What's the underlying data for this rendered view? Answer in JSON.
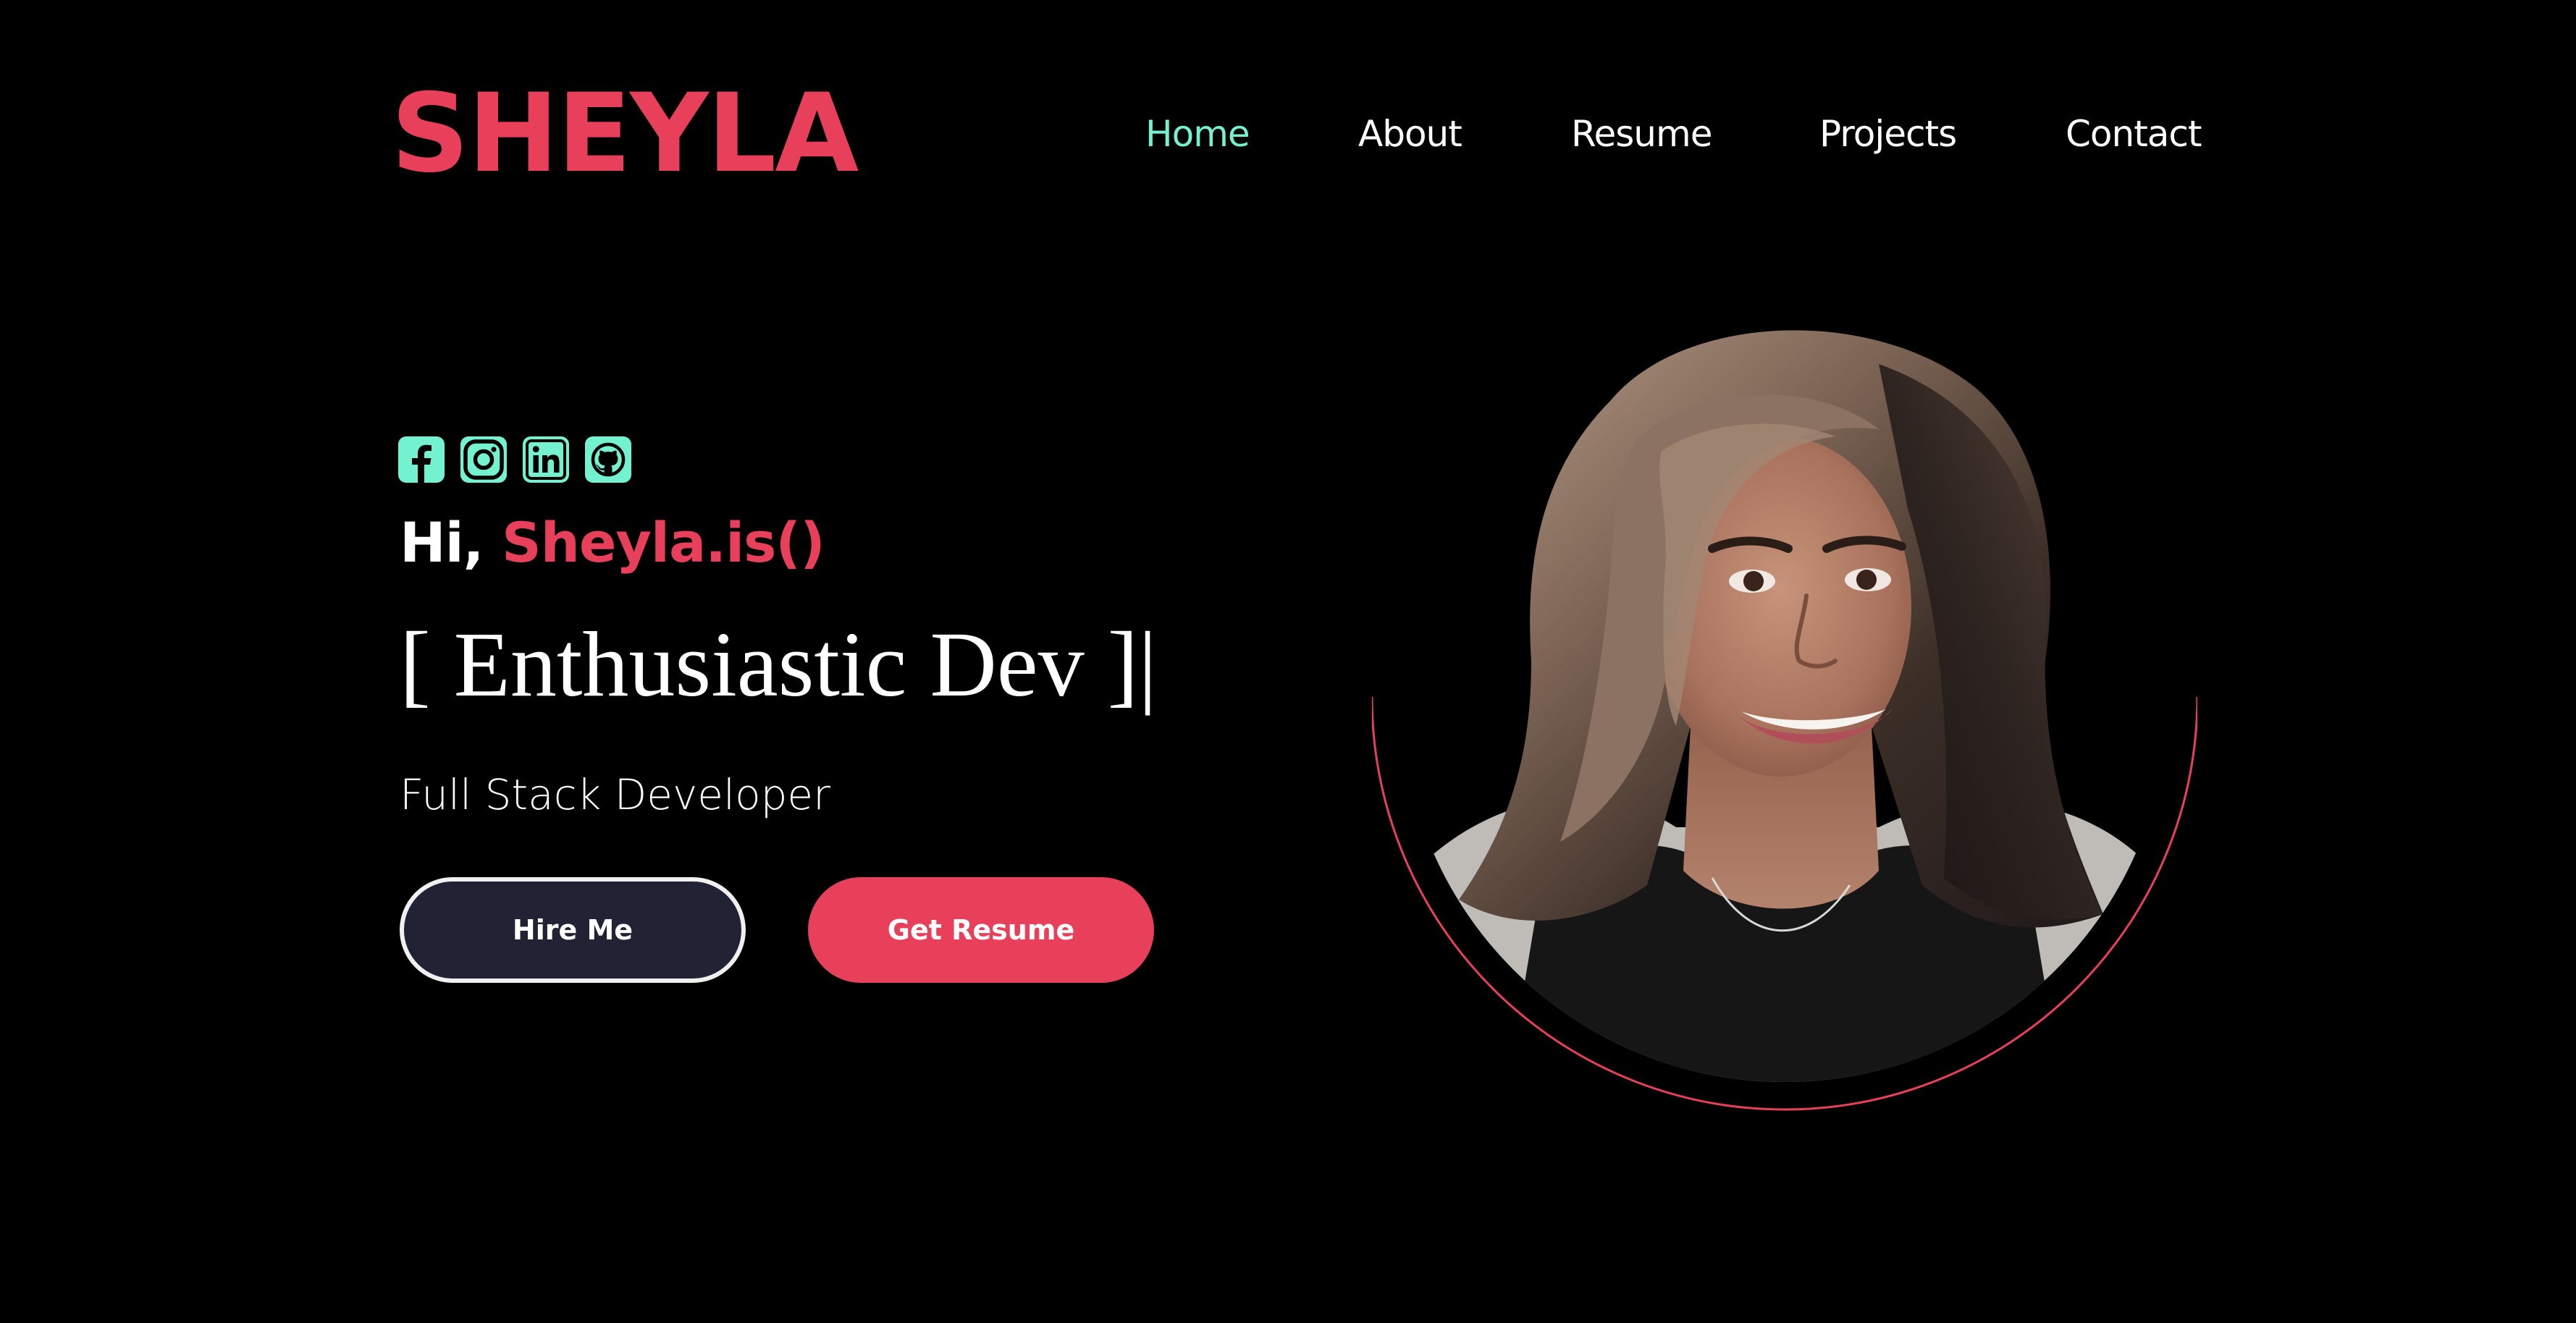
{
  "brand": {
    "logo": "SHEYLA",
    "color": "#e8405b"
  },
  "nav": {
    "items": [
      {
        "id": "home",
        "label": "Home",
        "active": true
      },
      {
        "id": "about",
        "label": "About",
        "active": false
      },
      {
        "id": "resume",
        "label": "Resume",
        "active": false
      },
      {
        "id": "projects",
        "label": "Projects",
        "active": false
      },
      {
        "id": "contact",
        "label": "Contact",
        "active": false
      }
    ],
    "active_color": "#74f2cf"
  },
  "socials": [
    {
      "icon": "facebook-icon"
    },
    {
      "icon": "instagram-icon"
    },
    {
      "icon": "linkedin-icon"
    },
    {
      "icon": "github-icon"
    }
  ],
  "hero": {
    "greeting_prefix": "Hi,",
    "greeting_name": "Sheyla.is()",
    "typed_text": "[ Enthusiastic Dev ]",
    "caret": "|",
    "role": "Full Stack Developer",
    "hire_button": "Hire Me",
    "resume_button": "Get Resume"
  },
  "portrait": {
    "icon": "profile-photo",
    "ring_color": "#e8405b"
  },
  "colors": {
    "background": "#000000",
    "accent": "#e8405b",
    "mint": "#74f2cf",
    "hire_bg": "#222235"
  }
}
